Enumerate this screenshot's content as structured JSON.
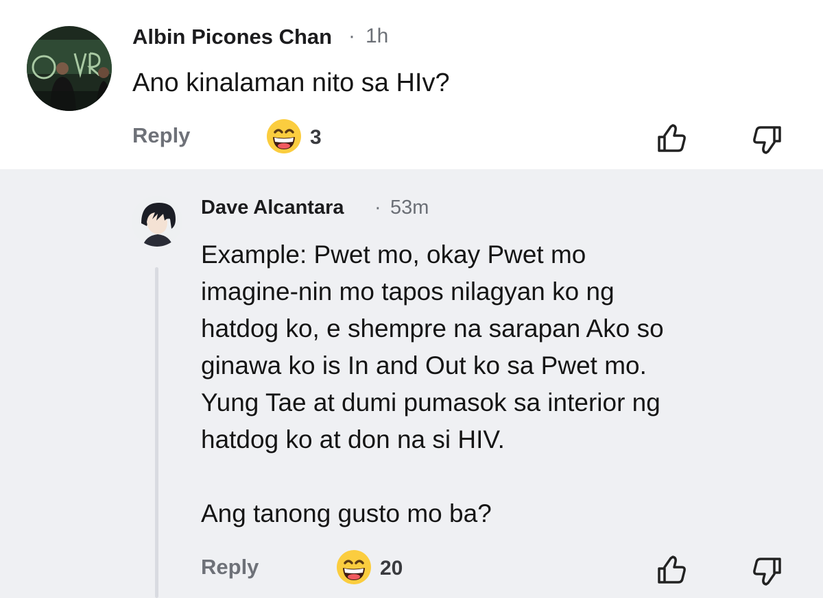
{
  "comment": {
    "author": "Albin Picones Chan",
    "separator": "·",
    "time": "1h",
    "text": "Ano kinalaman nito sa HIv?",
    "reply_label": "Reply",
    "reaction_icon": "grinning-face-emoji",
    "reaction_count": "3"
  },
  "reply": {
    "author": "Dave Alcantara",
    "separator": "·",
    "time": "53m",
    "text": "Example: Pwet mo, okay Pwet mo\nimagine-nin mo  tapos nilagyan ko ng\nhatdog ko, e shempre na sarapan Ako so\nginawa ko is In and Out ko sa Pwet mo.\nYung Tae at dumi pumasok sa interior ng\nhatdog ko at don na si HIV.\n\nAng tanong gusto mo ba?",
    "reply_label": "Reply",
    "reaction_icon": "grinning-face-emoji",
    "reaction_count": "20"
  },
  "colors": {
    "reply_background": "#eff0f3",
    "thread_line": "#d9dbe1",
    "muted_text": "#6e7178"
  }
}
